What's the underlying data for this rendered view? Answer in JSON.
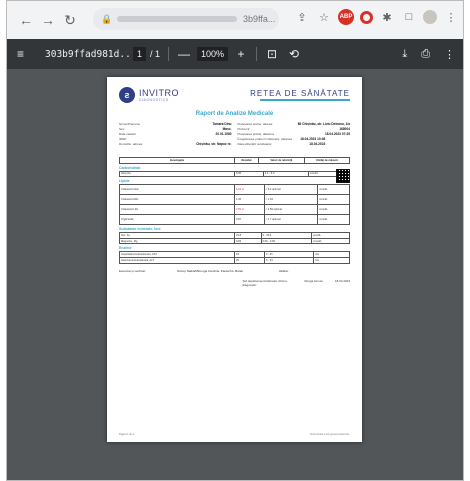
{
  "browser": {
    "url_suffix": "3b9ffa...",
    "lock_icon": "lock-icon"
  },
  "pdf_toolbar": {
    "file_name": "303b9ffad981d...",
    "page_current": "1",
    "page_total": "/ 1",
    "zoom": "100%"
  },
  "document": {
    "logo_name": "INVITRO",
    "logo_sub": "DIAGNOSTICS",
    "brand": "RETEA DE SĂNĂTATE",
    "title": "Raport de Analize Medicale",
    "patient_name_label": "Nume/Prenume",
    "patient_name": "Tamara Dinu",
    "gender_label": "Sex:",
    "gender": "Masc.",
    "age_label": "Data nasterii",
    "age": "20.01.1980",
    "idnp_label": "IDNP:",
    "address_label": "Domiciliu, adresa:",
    "address": "Chișinău, str. Napoc nr.",
    "lab_label": "Prelevarea probei, adresa:",
    "lab": "Mi Chișinău, str. Liviu Deleanu, 1/a",
    "probe_label": "Proba Nr:",
    "probe": "168004",
    "collect_label": "Prelevarea probei, data/ora",
    "collect": "18.04.2023 07:39",
    "reg_label": "Înregistrarea probei în laborator, data/ora",
    "reg": "18.04.2023 10:46",
    "issue_label": "Data eliberării rezultatelor",
    "issue": "18.04.2023",
    "col_test": "Investigație",
    "col_result": "Rezultat",
    "col_ref": "Valori de referință",
    "col_unit": "Unități de măsură",
    "sections": {
      "carbo": "Carbohidrați",
      "lipids": "Lipide",
      "minerals": "Substanțe minerale, ioni",
      "enzymes": "Enzime"
    },
    "rows": {
      "glucose": {
        "name": "Glucoza",
        "result": "5.00",
        "ref": "4.1 - 5.9",
        "unit": "mmol/L"
      },
      "chol": {
        "name": "Colesterol total",
        "result": "6.04",
        "ref": "< 5.2 optimal",
        "unit": "mmol/L"
      },
      "hdl": {
        "name": "Colesterol HDL",
        "result": "1.36",
        "ref": "> 1.04",
        "unit": "mmol/L"
      },
      "ldl": {
        "name": "Colesterol LDL",
        "result": "3.65",
        "ref": "< 2.59 optimal",
        "unit": "mmol/L"
      },
      "trig": {
        "name": "Trigliceride",
        "result": "0.87",
        "ref": "< 1.7 optimal",
        "unit": "mmol/L"
      },
      "fe": {
        "name": "Fier, Fe",
        "result": "21.8",
        "ref": "9 - 30.4",
        "unit": "µmol/L"
      },
      "mg": {
        "name": "Magneziu, Mg",
        "result": "0.83",
        "ref": "0.66 - 0.99",
        "unit": "mmol/L"
      },
      "alt": {
        "name": "Aspartataminotransferaza, AST",
        "result": "18",
        "ref": "0 - 31",
        "unit": "U/L"
      },
      "ast": {
        "name": "Alaninaminotransferaza, ALT",
        "result": "20",
        "ref": "0 - 33",
        "unit": "U/L"
      }
    },
    "flag": "H",
    "executed_label": "Executat și verificat:",
    "executed_names": "Rozup Nadia/Mitrenga Carolina, Paraschiv Maria/",
    "validated_label": "Validat:",
    "head_label": "Șef departament laborator clinico-diagnostic:",
    "head_name": "Rozga Ionosu",
    "head_date": "18.04.2023",
    "footer_left": "Pagina 1 din 1",
    "footer_right": "Documentul a fost generat electronic."
  }
}
